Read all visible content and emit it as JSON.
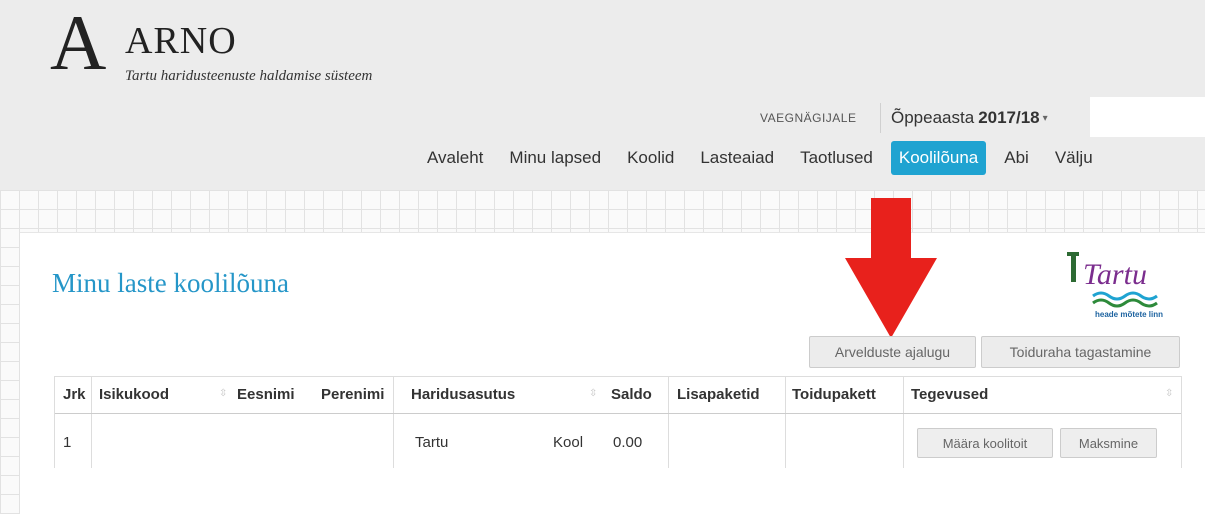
{
  "header": {
    "logo_letter": "A",
    "app_name": "ARNO",
    "subtitle": "Tartu haridusteenuste haldamise süsteem",
    "view_mode": "VAEGNÄGIJALE",
    "year_label": "Õppeaasta",
    "year_value": "2017/18",
    "caret": "▾"
  },
  "nav": {
    "items": [
      "Avaleht",
      "Minu lapsed",
      "Koolid",
      "Lasteaiad",
      "Taotlused",
      "Koolilõuna",
      "Abi",
      "Välju"
    ],
    "active": "Koolilõuna"
  },
  "main": {
    "title": "Minu laste koolilõuna",
    "logo_text": "Tartu",
    "logo_tagline": "heade mõtete linn",
    "buttons": [
      "Arvelduste ajalugu",
      "Toiduraha tagastamine"
    ],
    "annotation": "red-down-arrow"
  },
  "table": {
    "columns": [
      "Jrk",
      "Isikukood",
      "Eesnimi",
      "Perenimi",
      "Haridusasutus",
      "Saldo",
      "Lisapaketid",
      "Toidupakett",
      "Tegevused"
    ],
    "sort_icon": "⇳",
    "rows": [
      {
        "jrk": "1",
        "isikukood": "",
        "eesnimi": "",
        "perenimi": "",
        "haridusasutus": [
          "Tartu",
          "Kool"
        ],
        "saldo": "0.00",
        "lisapaketid": "",
        "toidupakett": "",
        "actions": [
          "Määra koolitoit",
          "Maksmine"
        ]
      }
    ]
  },
  "colors": {
    "accent": "#1fa3d1",
    "title": "#2596c8",
    "arrow": "#e8211c"
  }
}
